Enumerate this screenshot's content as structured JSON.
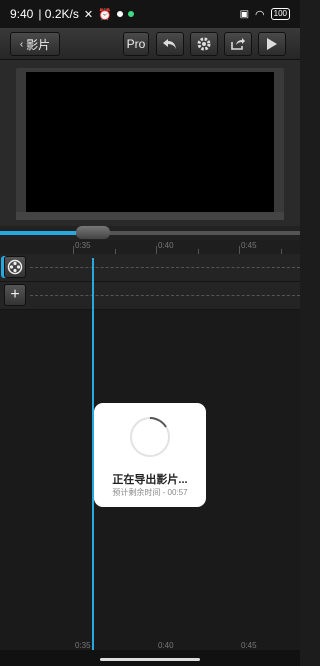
{
  "status_bar": {
    "time": "9:40",
    "speed": "| 0.2K/s",
    "battery": "100"
  },
  "toolbar": {
    "back_label": "影片",
    "pro_label": "Pro"
  },
  "ruler": {
    "labels": [
      "0:35",
      "0:40",
      "0:45"
    ]
  },
  "dialog": {
    "title": "正在导出影片...",
    "subtitle": "预计剩余时间 - 00:57"
  },
  "playback": {
    "progress_fraction": 0.28
  },
  "colors": {
    "accent": "#29a8e0",
    "background": "#1e1e1e"
  }
}
